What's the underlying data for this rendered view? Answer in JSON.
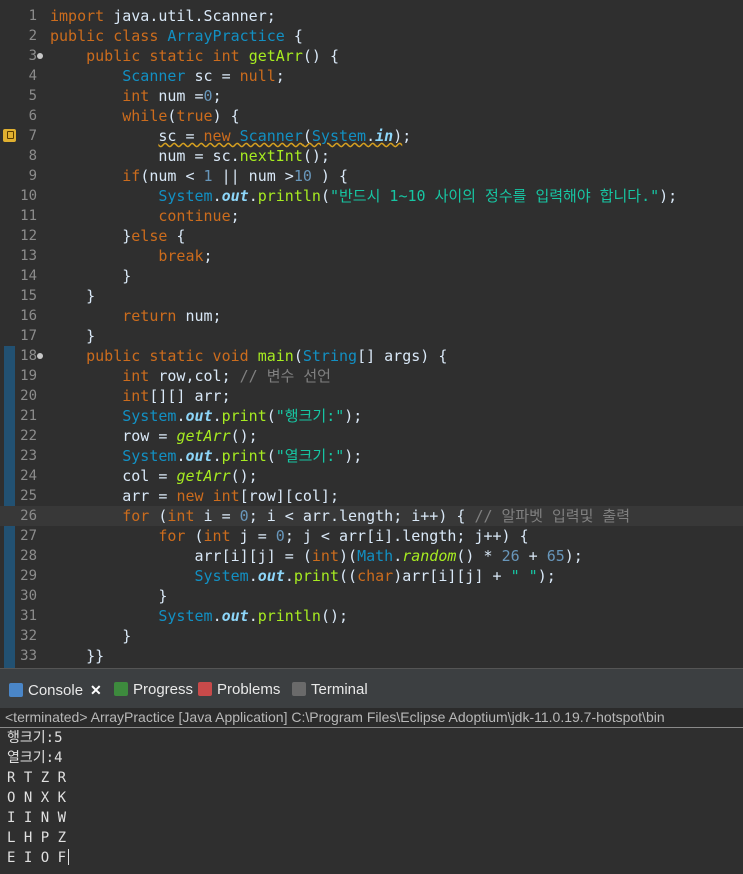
{
  "editor": {
    "lines": [
      {
        "n": "1",
        "s": [
          {
            "t": "import ",
            "c": "kw"
          },
          {
            "t": "java.util.Scanner;",
            "c": "vr"
          }
        ]
      },
      {
        "n": "2",
        "s": [
          {
            "t": "public class ",
            "c": "kw"
          },
          {
            "t": "ArrayPractice",
            "c": "ty"
          },
          {
            "t": " {",
            "c": "vr"
          }
        ]
      },
      {
        "n": "3",
        "fold": true,
        "s": [
          {
            "t": "    public static int ",
            "c": "kw"
          },
          {
            "t": "getArr",
            "c": "mt"
          },
          {
            "t": "() {",
            "c": "vr"
          }
        ]
      },
      {
        "n": "4",
        "s": [
          {
            "t": "        ",
            "c": "vr"
          },
          {
            "t": "Scanner",
            "c": "ty"
          },
          {
            "t": " sc = ",
            "c": "vr"
          },
          {
            "t": "null",
            "c": "kw"
          },
          {
            "t": ";",
            "c": "vr"
          }
        ]
      },
      {
        "n": "5",
        "s": [
          {
            "t": "        ",
            "c": "vr"
          },
          {
            "t": "int",
            "c": "kw"
          },
          {
            "t": " num =",
            "c": "vr"
          },
          {
            "t": "0",
            "c": "nm"
          },
          {
            "t": ";",
            "c": "vr"
          }
        ]
      },
      {
        "n": "6",
        "s": [
          {
            "t": "        ",
            "c": "vr"
          },
          {
            "t": "while",
            "c": "kw"
          },
          {
            "t": "(",
            "c": "vr"
          },
          {
            "t": "true",
            "c": "kw"
          },
          {
            "t": ") {",
            "c": "vr"
          }
        ]
      },
      {
        "n": "7",
        "warn": true,
        "s": [
          {
            "t": "            ",
            "c": "vr"
          },
          {
            "t": "sc = ",
            "c": "vr wavy"
          },
          {
            "t": "new ",
            "c": "kw wavy"
          },
          {
            "t": "Scanner",
            "c": "ty wavy"
          },
          {
            "t": "(",
            "c": "vr wavy"
          },
          {
            "t": "System",
            "c": "ty wavy"
          },
          {
            "t": ".",
            "c": "vr wavy"
          },
          {
            "t": "in",
            "c": "fi wavy"
          },
          {
            "t": ")",
            "c": "vr wavy"
          },
          {
            "t": ";",
            "c": "vr"
          }
        ]
      },
      {
        "n": "8",
        "s": [
          {
            "t": "            num = sc.",
            "c": "vr"
          },
          {
            "t": "nextInt",
            "c": "mt"
          },
          {
            "t": "();",
            "c": "vr"
          }
        ]
      },
      {
        "n": "9",
        "s": [
          {
            "t": "        ",
            "c": "vr"
          },
          {
            "t": "if",
            "c": "kw"
          },
          {
            "t": "(num < ",
            "c": "vr"
          },
          {
            "t": "1",
            "c": "nm"
          },
          {
            "t": " || num >",
            "c": "vr"
          },
          {
            "t": "10",
            "c": "nm"
          },
          {
            "t": " ) {",
            "c": "vr"
          }
        ]
      },
      {
        "n": "10",
        "s": [
          {
            "t": "            ",
            "c": "vr"
          },
          {
            "t": "System",
            "c": "ty"
          },
          {
            "t": ".",
            "c": "vr"
          },
          {
            "t": "out",
            "c": "fi"
          },
          {
            "t": ".",
            "c": "vr"
          },
          {
            "t": "println",
            "c": "mt"
          },
          {
            "t": "(",
            "c": "vr"
          },
          {
            "t": "\"반드시 1~10 사이의 정수를 입력해야 합니다.\"",
            "c": "st"
          },
          {
            "t": ");",
            "c": "vr"
          }
        ]
      },
      {
        "n": "11",
        "s": [
          {
            "t": "            ",
            "c": "vr"
          },
          {
            "t": "continue",
            "c": "kw"
          },
          {
            "t": ";",
            "c": "vr"
          }
        ]
      },
      {
        "n": "12",
        "s": [
          {
            "t": "        }",
            "c": "vr"
          },
          {
            "t": "else",
            "c": "kw"
          },
          {
            "t": " {",
            "c": "vr"
          }
        ]
      },
      {
        "n": "13",
        "s": [
          {
            "t": "            ",
            "c": "vr"
          },
          {
            "t": "break",
            "c": "kw"
          },
          {
            "t": ";",
            "c": "vr"
          }
        ]
      },
      {
        "n": "14",
        "s": [
          {
            "t": "        }",
            "c": "vr"
          }
        ]
      },
      {
        "n": "15",
        "s": [
          {
            "t": "    }",
            "c": "vr"
          }
        ]
      },
      {
        "n": "16",
        "s": [
          {
            "t": "        ",
            "c": "vr"
          },
          {
            "t": "return",
            "c": "kw"
          },
          {
            "t": " num;",
            "c": "vr"
          }
        ]
      },
      {
        "n": "17",
        "s": [
          {
            "t": "    }",
            "c": "vr"
          }
        ]
      },
      {
        "n": "18",
        "fold": true,
        "s": [
          {
            "t": "    public static void ",
            "c": "kw"
          },
          {
            "t": "main",
            "c": "mt"
          },
          {
            "t": "(",
            "c": "vr"
          },
          {
            "t": "String",
            "c": "ty"
          },
          {
            "t": "[] args) {",
            "c": "vr"
          }
        ]
      },
      {
        "n": "19",
        "s": [
          {
            "t": "        ",
            "c": "vr"
          },
          {
            "t": "int",
            "c": "kw"
          },
          {
            "t": " row,col; ",
            "c": "vr"
          },
          {
            "t": "// 변수 선언",
            "c": "cm"
          }
        ]
      },
      {
        "n": "20",
        "s": [
          {
            "t": "        ",
            "c": "vr"
          },
          {
            "t": "int",
            "c": "kw"
          },
          {
            "t": "[][] arr;",
            "c": "vr"
          }
        ]
      },
      {
        "n": "21",
        "s": [
          {
            "t": "        ",
            "c": "vr"
          },
          {
            "t": "System",
            "c": "ty"
          },
          {
            "t": ".",
            "c": "vr"
          },
          {
            "t": "out",
            "c": "fi"
          },
          {
            "t": ".",
            "c": "vr"
          },
          {
            "t": "print",
            "c": "mt"
          },
          {
            "t": "(",
            "c": "vr"
          },
          {
            "t": "\"행크기:\"",
            "c": "st"
          },
          {
            "t": ");",
            "c": "vr"
          }
        ]
      },
      {
        "n": "22",
        "s": [
          {
            "t": "        row = ",
            "c": "vr"
          },
          {
            "t": "getArr",
            "c": "sm"
          },
          {
            "t": "();",
            "c": "vr"
          }
        ]
      },
      {
        "n": "23",
        "s": [
          {
            "t": "        ",
            "c": "vr"
          },
          {
            "t": "System",
            "c": "ty"
          },
          {
            "t": ".",
            "c": "vr"
          },
          {
            "t": "out",
            "c": "fi"
          },
          {
            "t": ".",
            "c": "vr"
          },
          {
            "t": "print",
            "c": "mt"
          },
          {
            "t": "(",
            "c": "vr"
          },
          {
            "t": "\"열크기:\"",
            "c": "st"
          },
          {
            "t": ");",
            "c": "vr"
          }
        ]
      },
      {
        "n": "24",
        "s": [
          {
            "t": "        col = ",
            "c": "vr"
          },
          {
            "t": "getArr",
            "c": "sm"
          },
          {
            "t": "();",
            "c": "vr"
          }
        ]
      },
      {
        "n": "25",
        "s": [
          {
            "t": "        arr = ",
            "c": "vr"
          },
          {
            "t": "new ",
            "c": "kw"
          },
          {
            "t": "int",
            "c": "kw"
          },
          {
            "t": "[row][col];",
            "c": "vr"
          }
        ]
      },
      {
        "n": "26",
        "cur": true,
        "s": [
          {
            "t": "        ",
            "c": "vr"
          },
          {
            "t": "for",
            "c": "kw"
          },
          {
            "t": " (",
            "c": "vr"
          },
          {
            "t": "int",
            "c": "kw"
          },
          {
            "t": " i = ",
            "c": "vr"
          },
          {
            "t": "0",
            "c": "nm"
          },
          {
            "t": "; i < arr.",
            "c": "vr"
          },
          {
            "t": "length",
            "c": "vr"
          },
          {
            "t": "; i++) { ",
            "c": "vr"
          },
          {
            "t": "// 알파벳 입력및 출력",
            "c": "cm"
          }
        ]
      },
      {
        "n": "27",
        "s": [
          {
            "t": "            ",
            "c": "vr"
          },
          {
            "t": "for",
            "c": "kw"
          },
          {
            "t": " (",
            "c": "vr"
          },
          {
            "t": "int",
            "c": "kw"
          },
          {
            "t": " j = ",
            "c": "vr"
          },
          {
            "t": "0",
            "c": "nm"
          },
          {
            "t": "; j < arr[i].",
            "c": "vr"
          },
          {
            "t": "length",
            "c": "vr"
          },
          {
            "t": "; j++) {",
            "c": "vr"
          }
        ]
      },
      {
        "n": "28",
        "s": [
          {
            "t": "                arr[i][j] = (",
            "c": "vr"
          },
          {
            "t": "int",
            "c": "kw"
          },
          {
            "t": ")(",
            "c": "vr"
          },
          {
            "t": "Math",
            "c": "ty"
          },
          {
            "t": ".",
            "c": "vr"
          },
          {
            "t": "random",
            "c": "sm"
          },
          {
            "t": "() * ",
            "c": "vr"
          },
          {
            "t": "26",
            "c": "nm"
          },
          {
            "t": " + ",
            "c": "vr"
          },
          {
            "t": "65",
            "c": "nm"
          },
          {
            "t": ");",
            "c": "vr"
          }
        ]
      },
      {
        "n": "29",
        "s": [
          {
            "t": "                ",
            "c": "vr"
          },
          {
            "t": "System",
            "c": "ty"
          },
          {
            "t": ".",
            "c": "vr"
          },
          {
            "t": "out",
            "c": "fi"
          },
          {
            "t": ".",
            "c": "vr"
          },
          {
            "t": "print",
            "c": "mt"
          },
          {
            "t": "((",
            "c": "vr"
          },
          {
            "t": "char",
            "c": "kw"
          },
          {
            "t": ")arr[i][j] + ",
            "c": "vr"
          },
          {
            "t": "\" \"",
            "c": "st"
          },
          {
            "t": ");",
            "c": "vr"
          }
        ]
      },
      {
        "n": "30",
        "s": [
          {
            "t": "            }",
            "c": "vr"
          }
        ]
      },
      {
        "n": "31",
        "s": [
          {
            "t": "            ",
            "c": "vr"
          },
          {
            "t": "System",
            "c": "ty"
          },
          {
            "t": ".",
            "c": "vr"
          },
          {
            "t": "out",
            "c": "fi"
          },
          {
            "t": ".",
            "c": "vr"
          },
          {
            "t": "println",
            "c": "mt"
          },
          {
            "t": "();",
            "c": "vr"
          }
        ]
      },
      {
        "n": "32",
        "s": [
          {
            "t": "        }",
            "c": "vr"
          }
        ]
      },
      {
        "n": "33",
        "s": [
          {
            "t": "    }}",
            "c": "vr"
          }
        ]
      }
    ]
  },
  "tabs": [
    {
      "label": "Console",
      "close": "✕",
      "active": true
    },
    {
      "label": "Progress"
    },
    {
      "label": "Problems"
    },
    {
      "label": "Terminal"
    }
  ],
  "console": {
    "status": "<terminated> ArrayPractice [Java Application] C:\\Program Files\\Eclipse Adoptium\\jdk-11.0.19.7-hotspot\\bin",
    "output": [
      "행크기:5",
      "열크기:4",
      "R T Z R",
      "O N X K",
      "I I N W",
      "L H P Z",
      "E I O F"
    ]
  }
}
